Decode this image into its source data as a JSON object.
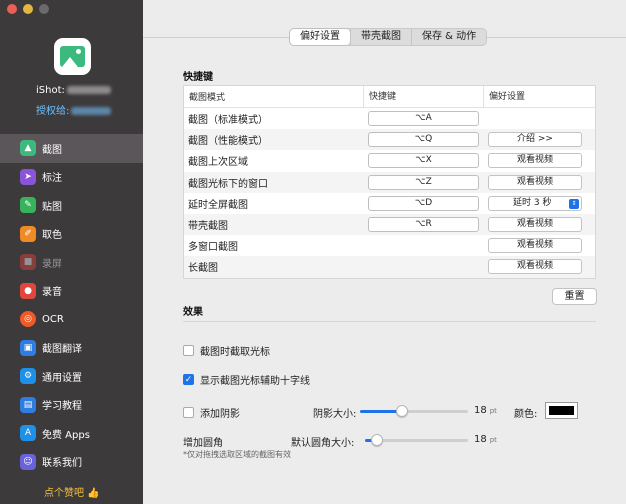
{
  "window": {
    "controls": [
      "close",
      "minimize",
      "zoom"
    ]
  },
  "sidebar": {
    "user_label": "iShot:",
    "auth_label": "授权给:",
    "items": [
      {
        "label": "截图",
        "icon": "screenshot-icon",
        "color": "#3cb97c",
        "active": true
      },
      {
        "label": "标注",
        "icon": "cursor-icon",
        "color": "#8a54d8"
      },
      {
        "label": "贴图",
        "icon": "pin-icon",
        "color": "#38b35c"
      },
      {
        "label": "取色",
        "icon": "color-picker-icon",
        "color": "#f08a24"
      },
      {
        "label": "录屏",
        "icon": "video-icon",
        "color": "#e2453c",
        "dim": true
      },
      {
        "label": "录音",
        "icon": "microphone-icon",
        "color": "#e2453c"
      },
      {
        "label": "OCR",
        "icon": "ocr-icon",
        "color": "#f05a28"
      },
      {
        "label": "截图翻译",
        "icon": "translate-icon",
        "color": "#2f7de1"
      },
      {
        "label": "通用设置",
        "icon": "settings-icon",
        "color": "#1e90e8"
      },
      {
        "label": "学习教程",
        "icon": "tutorial-icon",
        "color": "#2f7de1"
      },
      {
        "label": "免费 Apps",
        "icon": "appstore-icon",
        "color": "#1e90e8"
      },
      {
        "label": "联系我们",
        "icon": "contact-icon",
        "color": "#6a62d8"
      }
    ],
    "like_label": "点个赞吧 👍"
  },
  "tabs": [
    {
      "label": "偏好设置",
      "selected": true
    },
    {
      "label": "带壳截图"
    },
    {
      "label": "保存 & 动作"
    }
  ],
  "shortcuts": {
    "title": "快捷键",
    "headers": [
      "截图模式",
      "快捷键",
      "偏好设置"
    ],
    "rows": [
      {
        "mode": "截图（标准模式）",
        "key": "⌥A",
        "pref": ""
      },
      {
        "mode": "截图（性能模式）",
        "key": "⌥Q",
        "pref": "介绍  >>",
        "pref_type": "button"
      },
      {
        "mode": "截图上次区域",
        "key": "⌥X",
        "pref": "观看视频",
        "pref_type": "button"
      },
      {
        "mode": "截图光标下的窗口",
        "key": "⌥Z",
        "pref": "观看视频",
        "pref_type": "button"
      },
      {
        "mode": "延时全屏截图",
        "key": "⌥D",
        "pref": "延时 3 秒",
        "pref_type": "select"
      },
      {
        "mode": "带壳截图",
        "key": "⌥R",
        "pref": "观看视频",
        "pref_type": "button"
      },
      {
        "mode": "多窗口截图",
        "key": "",
        "pref": "观看视频",
        "pref_type": "button"
      },
      {
        "mode": "长截图",
        "key": "",
        "pref": "观看视频",
        "pref_type": "button"
      }
    ],
    "reset_label": "重置"
  },
  "effects": {
    "title": "效果",
    "capture_cursor": {
      "label": "截图时截取光标",
      "checked": false
    },
    "crosshair": {
      "label": "显示截图光标辅助十字线",
      "checked": true
    },
    "shadow": {
      "label": "添加阴影",
      "checked": false
    },
    "shadow_size_label": "阴影大小:",
    "shadow_size_value": "18",
    "shadow_size_fraction": 0.37,
    "unit": "pt",
    "color_label": "颜色:",
    "shadow_color": "#000000",
    "corner_label": "增加圆角",
    "corner_size_label": "默认圆角大小:",
    "corner_size_value": "18",
    "corner_size_fraction": 0.07,
    "note": "*仅对拖拽选取区域的截图有效"
  }
}
